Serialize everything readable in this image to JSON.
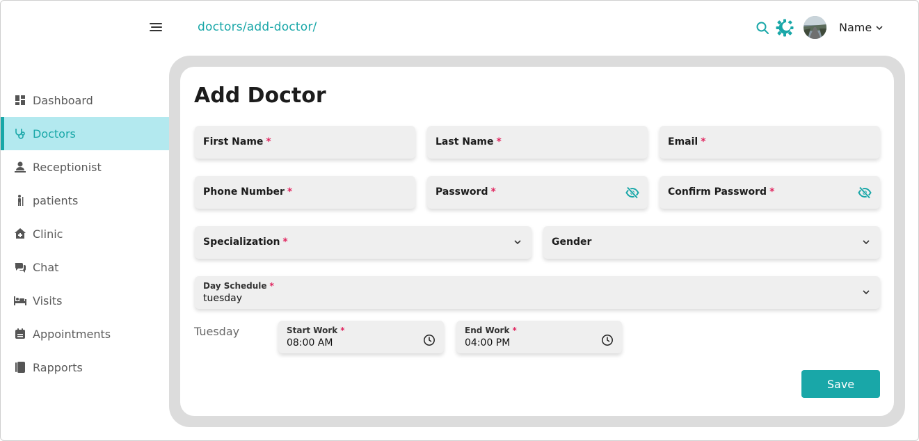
{
  "header": {
    "breadcrumb": "doctors/add-doctor/",
    "user_name": "Name",
    "icons": {
      "menu": "hamburger-menu-icon",
      "search": "search-icon",
      "theme": "theme-toggle-icon",
      "user_menu": "chevron-down-icon"
    }
  },
  "colors": {
    "accent": "#19a7a8",
    "active_nav_bg": "#b3e9ef",
    "required": "#e0245e",
    "card_border": "#dcdcdc"
  },
  "sidebar": {
    "items": [
      {
        "label": "Dashboard",
        "icon": "dashboard-icon",
        "active": false
      },
      {
        "label": "Doctors",
        "icon": "stethoscope-icon",
        "active": true
      },
      {
        "label": "Receptionist",
        "icon": "receptionist-icon",
        "active": false
      },
      {
        "label": "patients",
        "icon": "patient-icon",
        "active": false
      },
      {
        "label": "Clinic",
        "icon": "clinic-icon",
        "active": false
      },
      {
        "label": "Chat",
        "icon": "chat-icon",
        "active": false
      },
      {
        "label": "Visits",
        "icon": "bed-icon",
        "active": false
      },
      {
        "label": "Appointments",
        "icon": "calendar-icon",
        "active": false
      },
      {
        "label": "Rapports",
        "icon": "report-icon",
        "active": false
      }
    ]
  },
  "form": {
    "title": "Add Doctor",
    "required_mark": "*",
    "first_name": {
      "label": "First Name",
      "value": ""
    },
    "last_name": {
      "label": "Last Name",
      "value": ""
    },
    "email": {
      "label": "Email",
      "value": ""
    },
    "phone": {
      "label": "Phone Number",
      "value": ""
    },
    "password": {
      "label": "Password",
      "value": "",
      "icon": "eye-off-icon"
    },
    "confirm_password": {
      "label": "Confirm Password",
      "value": "",
      "icon": "eye-off-icon"
    },
    "specialization": {
      "label": "Specialization",
      "value": ""
    },
    "gender": {
      "label": "Gender",
      "value": ""
    },
    "day_schedule": {
      "label": "Day Schedule",
      "value": "tuesday"
    },
    "schedule": {
      "day": "Tuesday",
      "start": {
        "label": "Start Work",
        "value": "08:00 AM",
        "icon": "clock-icon"
      },
      "end": {
        "label": "End Work",
        "value": "04:00 PM",
        "icon": "clock-icon"
      }
    },
    "save_label": "Save"
  }
}
